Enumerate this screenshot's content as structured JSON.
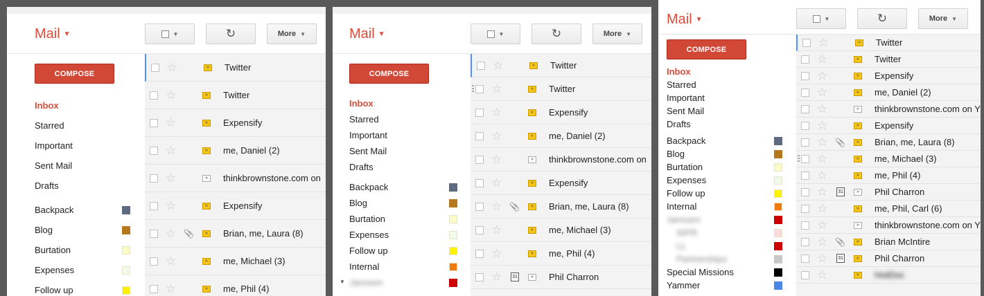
{
  "app": {
    "title": "Mail",
    "toolbar": {
      "more_label": "More",
      "refresh_icon": "refresh-icon",
      "select_icon": "checkbox-icon"
    },
    "compose_label": "COMPOSE",
    "colors": {
      "brand_red": "#dd4b39",
      "compose_red": "#d14836",
      "important_yellow": "#f5c518",
      "selection_blue": "#4d90fe"
    }
  },
  "panel1": {
    "nav": [
      {
        "label": "Inbox",
        "active": true
      },
      {
        "label": "Starred"
      },
      {
        "label": "Important"
      },
      {
        "label": "Sent Mail"
      },
      {
        "label": "Drafts"
      }
    ],
    "labels": [
      {
        "label": "Backpack",
        "color": "#5e6a7f"
      },
      {
        "label": "Blog",
        "color": "#b5781e"
      },
      {
        "label": "Burtation",
        "color": "#fbfbc8"
      },
      {
        "label": "Expenses",
        "color": "#f2fbe9"
      },
      {
        "label": "Follow up",
        "color": "#fff200"
      }
    ],
    "rows": [
      {
        "sender": "Twitter",
        "important": true
      },
      {
        "sender": "Twitter",
        "important": true
      },
      {
        "sender": "Expensify",
        "important": true
      },
      {
        "sender": "me, Daniel (2)",
        "important": true
      },
      {
        "sender": "thinkbrownstone.com on",
        "important": false
      },
      {
        "sender": "Expensify",
        "important": true
      },
      {
        "sender": "Brian, me, Laura (8)",
        "important": true,
        "attachment": true
      },
      {
        "sender": "me, Michael (3)",
        "important": true
      },
      {
        "sender": "me, Phil (4)",
        "important": true
      }
    ]
  },
  "panel2": {
    "nav": [
      {
        "label": "Inbox",
        "active": true
      },
      {
        "label": "Starred"
      },
      {
        "label": "Important"
      },
      {
        "label": "Sent Mail"
      },
      {
        "label": "Drafts"
      }
    ],
    "labels": [
      {
        "label": "Backpack",
        "color": "#5e6a7f"
      },
      {
        "label": "Blog",
        "color": "#b5781e"
      },
      {
        "label": "Burtation",
        "color": "#fbfbc8"
      },
      {
        "label": "Expenses",
        "color": "#f2fbe9"
      },
      {
        "label": "Follow up",
        "color": "#fff200"
      },
      {
        "label": "Internal",
        "color": "#f07b0c"
      },
      {
        "label": "Janssen",
        "color": "#cc0000",
        "blurred": true
      }
    ],
    "rows": [
      {
        "sender": "Twitter",
        "important": true
      },
      {
        "sender": "Twitter",
        "important": true
      },
      {
        "sender": "Expensify",
        "important": true
      },
      {
        "sender": "me, Daniel (2)",
        "important": true
      },
      {
        "sender": "thinkbrownstone.com on",
        "important": false
      },
      {
        "sender": "Expensify",
        "important": true
      },
      {
        "sender": "Brian, me, Laura (8)",
        "important": true,
        "attachment": true
      },
      {
        "sender": "me, Michael (3)",
        "important": true
      },
      {
        "sender": "me, Phil (4)",
        "important": true
      },
      {
        "sender": "Phil Charron",
        "important": false,
        "calendar": "31"
      }
    ]
  },
  "panel3": {
    "nav": [
      {
        "label": "Inbox",
        "active": true
      },
      {
        "label": "Starred"
      },
      {
        "label": "Important"
      },
      {
        "label": "Sent Mail"
      },
      {
        "label": "Drafts"
      }
    ],
    "labels": [
      {
        "label": "Backpack",
        "color": "#5e6a7f"
      },
      {
        "label": "Blog",
        "color": "#b5781e"
      },
      {
        "label": "Burtation",
        "color": "#fbfbc8"
      },
      {
        "label": "Expenses",
        "color": "#f2fbe9"
      },
      {
        "label": "Follow up",
        "color": "#fff200"
      },
      {
        "label": "Internal",
        "color": "#f07b0c"
      },
      {
        "label": "Janssen",
        "color": "#cc0000",
        "blurred": true
      },
      {
        "label": "SIPR",
        "color": "#fbdcdc",
        "blurred": true,
        "sub": true
      },
      {
        "label": "LL",
        "color": "#cc0000",
        "blurred": true,
        "sub": true
      },
      {
        "label": "Partnerships",
        "color": "#c8c8c8",
        "blurred": true,
        "sub": true
      },
      {
        "label": "Special Missions",
        "color": "#000000"
      },
      {
        "label": "Yammer",
        "color": "#4a86e8"
      }
    ],
    "rows": [
      {
        "sender": "Twitter",
        "important": true
      },
      {
        "sender": "Twitter",
        "important": true
      },
      {
        "sender": "Expensify",
        "important": true
      },
      {
        "sender": "me, Daniel (2)",
        "important": true
      },
      {
        "sender": "thinkbrownstone.com on Y",
        "important": false
      },
      {
        "sender": "Expensify",
        "important": true
      },
      {
        "sender": "Brian, me, Laura (8)",
        "important": true,
        "attachment": true
      },
      {
        "sender": "me, Michael (3)",
        "important": true
      },
      {
        "sender": "me, Phil (4)",
        "important": true
      },
      {
        "sender": "Phil Charron",
        "important": false,
        "calendar": "31"
      },
      {
        "sender": "me, Phil, Carl (6)",
        "important": true
      },
      {
        "sender": "thinkbrownstone.com on Y",
        "important": false
      },
      {
        "sender": "Brian McIntire",
        "important": true,
        "attachment": true
      },
      {
        "sender": "Phil Charron",
        "important": true,
        "calendar": "31"
      },
      {
        "sender": "HotDoc",
        "important": true,
        "blurred": true
      }
    ]
  }
}
